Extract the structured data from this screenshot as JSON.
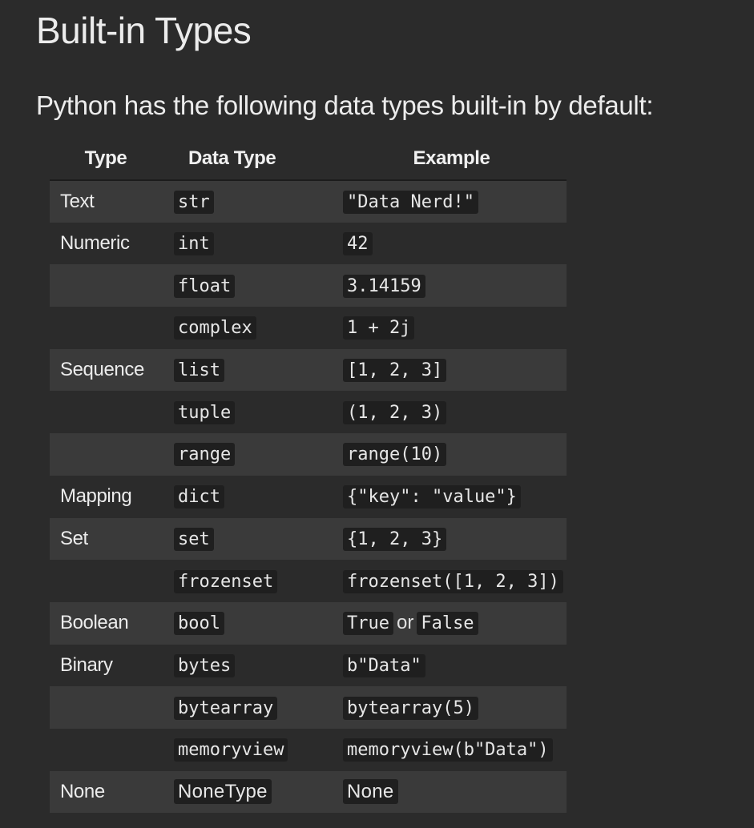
{
  "title": "Built-in Types",
  "intro": "Python has the following data types built-in by default:",
  "table": {
    "headers": {
      "type": "Type",
      "data_type": "Data Type",
      "example": "Example"
    },
    "rows": [
      {
        "type": "Text",
        "data_type": "str",
        "example": "\"Data Nerd!\""
      },
      {
        "type": "Numeric",
        "data_type": "int",
        "example": "42"
      },
      {
        "type": "",
        "data_type": "float",
        "example": "3.14159"
      },
      {
        "type": "",
        "data_type": "complex",
        "example": "1 + 2j"
      },
      {
        "type": "Sequence",
        "data_type": "list",
        "example": "[1, 2, 3]"
      },
      {
        "type": "",
        "data_type": "tuple",
        "example": "(1, 2, 3)"
      },
      {
        "type": "",
        "data_type": "range",
        "example": "range(10)"
      },
      {
        "type": "Mapping",
        "data_type": "dict",
        "example": "{\"key\": \"value\"}"
      },
      {
        "type": "Set",
        "data_type": "set",
        "example": "{1, 2, 3}"
      },
      {
        "type": "",
        "data_type": "frozenset",
        "example": "frozenset([1, 2, 3])"
      },
      {
        "type": "Boolean",
        "data_type": "bool",
        "example": "True",
        "example_joiner": "or",
        "example_extra": "False"
      },
      {
        "type": "Binary",
        "data_type": "bytes",
        "example": "b\"Data\""
      },
      {
        "type": "",
        "data_type": "bytearray",
        "example": "bytearray(5)"
      },
      {
        "type": "",
        "data_type": "memoryview",
        "example": "memoryview(b\"Data\")"
      },
      {
        "type": "None",
        "data_type": "NoneType",
        "example": "None"
      }
    ]
  }
}
